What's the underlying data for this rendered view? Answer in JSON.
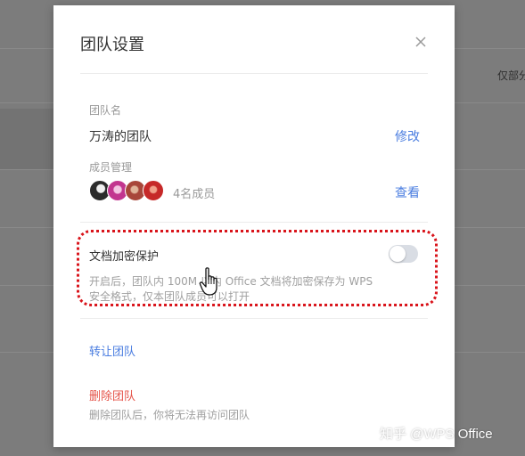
{
  "background": {
    "right_text": "仅部分"
  },
  "dialog": {
    "title": "团队设置",
    "team_name": {
      "label": "团队名",
      "value": "万涛的团队",
      "action": "修改"
    },
    "members": {
      "label": "成员管理",
      "count_text": "4名成员",
      "action": "查看",
      "avatar_colors": [
        "#2b2b2b",
        "#c2368f",
        "#a8463a",
        "#c62828"
      ]
    },
    "encryption": {
      "label": "文档加密保护",
      "description_line1": "开启后，团队内 100M 以内 Office 文档将加密保存为 WPS",
      "description_line2": "安全格式，仅本团队成员可以打开",
      "enabled": false
    },
    "transfer": {
      "label": "转让团队"
    },
    "delete": {
      "label": "删除团队",
      "hint": "删除团队后，你将无法再访问团队"
    }
  },
  "watermark": "知乎 @WPS Office",
  "colors": {
    "link": "#4a7de0",
    "danger": "#e5544a",
    "highlight": "#d9141b"
  }
}
